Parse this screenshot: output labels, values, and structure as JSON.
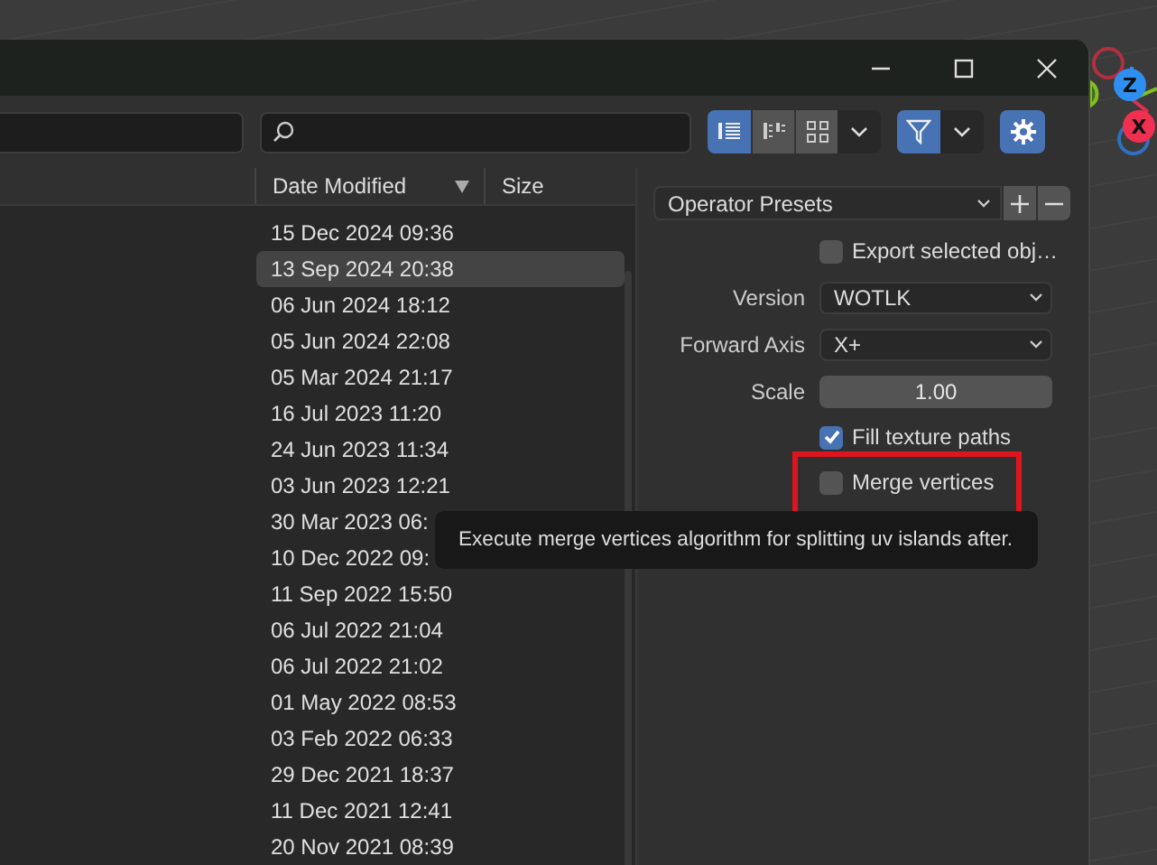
{
  "toolbar": {
    "display_modes": [
      {
        "kind": "vertical-list",
        "selected": true
      },
      {
        "kind": "horizontal-list",
        "selected": false
      },
      {
        "kind": "thumbnails",
        "selected": false
      }
    ],
    "filter": {
      "on": true
    }
  },
  "file_list": {
    "columns": [
      "Date Modified",
      "Size"
    ],
    "rows": [
      {
        "date": "15 Dec 2024 09:36",
        "selected": false
      },
      {
        "date": "13 Sep 2024 20:38",
        "selected": true
      },
      {
        "date": "06 Jun 2024 18:12",
        "selected": false
      },
      {
        "date": "05 Jun 2024 22:08",
        "selected": false
      },
      {
        "date": "05 Mar 2024 21:17",
        "selected": false
      },
      {
        "date": "16 Jul 2023 11:20",
        "selected": false
      },
      {
        "date": "24 Jun 2023 11:34",
        "selected": false
      },
      {
        "date": "03 Jun 2023 12:21",
        "selected": false
      },
      {
        "date": "30 Mar 2023 06:",
        "selected": false
      },
      {
        "date": "10 Dec 2022 09:",
        "selected": false
      },
      {
        "date": "11 Sep 2022 15:50",
        "selected": false
      },
      {
        "date": "06 Jul 2022 21:04",
        "selected": false
      },
      {
        "date": "06 Jul 2022 21:02",
        "selected": false
      },
      {
        "date": "01 May 2022 08:53",
        "selected": false
      },
      {
        "date": "03 Feb 2022 06:33",
        "selected": false
      },
      {
        "date": "29 Dec 2021 18:37",
        "selected": false
      },
      {
        "date": "11 Dec 2021 12:41",
        "selected": false
      },
      {
        "date": "20 Nov 2021 08:39",
        "selected": false
      }
    ]
  },
  "panel": {
    "presets": "Operator Presets",
    "options": [
      {
        "kind": "checkbox",
        "label": "Export selected obj…",
        "checked": false,
        "highlighted": false
      },
      {
        "kind": "dropdown",
        "label": "Version",
        "value": "WOTLK"
      },
      {
        "kind": "dropdown",
        "label": "Forward Axis",
        "value": "X+"
      },
      {
        "kind": "number",
        "label": "Scale",
        "value": "1.00"
      },
      {
        "kind": "checkbox",
        "label": "Fill texture paths",
        "checked": true,
        "highlighted": false
      },
      {
        "kind": "checkbox",
        "label": "Merge vertices",
        "checked": false,
        "highlighted": true
      }
    ]
  },
  "tooltip": "Execute merge vertices algorithm for splitting uv islands after.",
  "gizmo": {
    "axes": [
      "Z",
      "X"
    ]
  }
}
